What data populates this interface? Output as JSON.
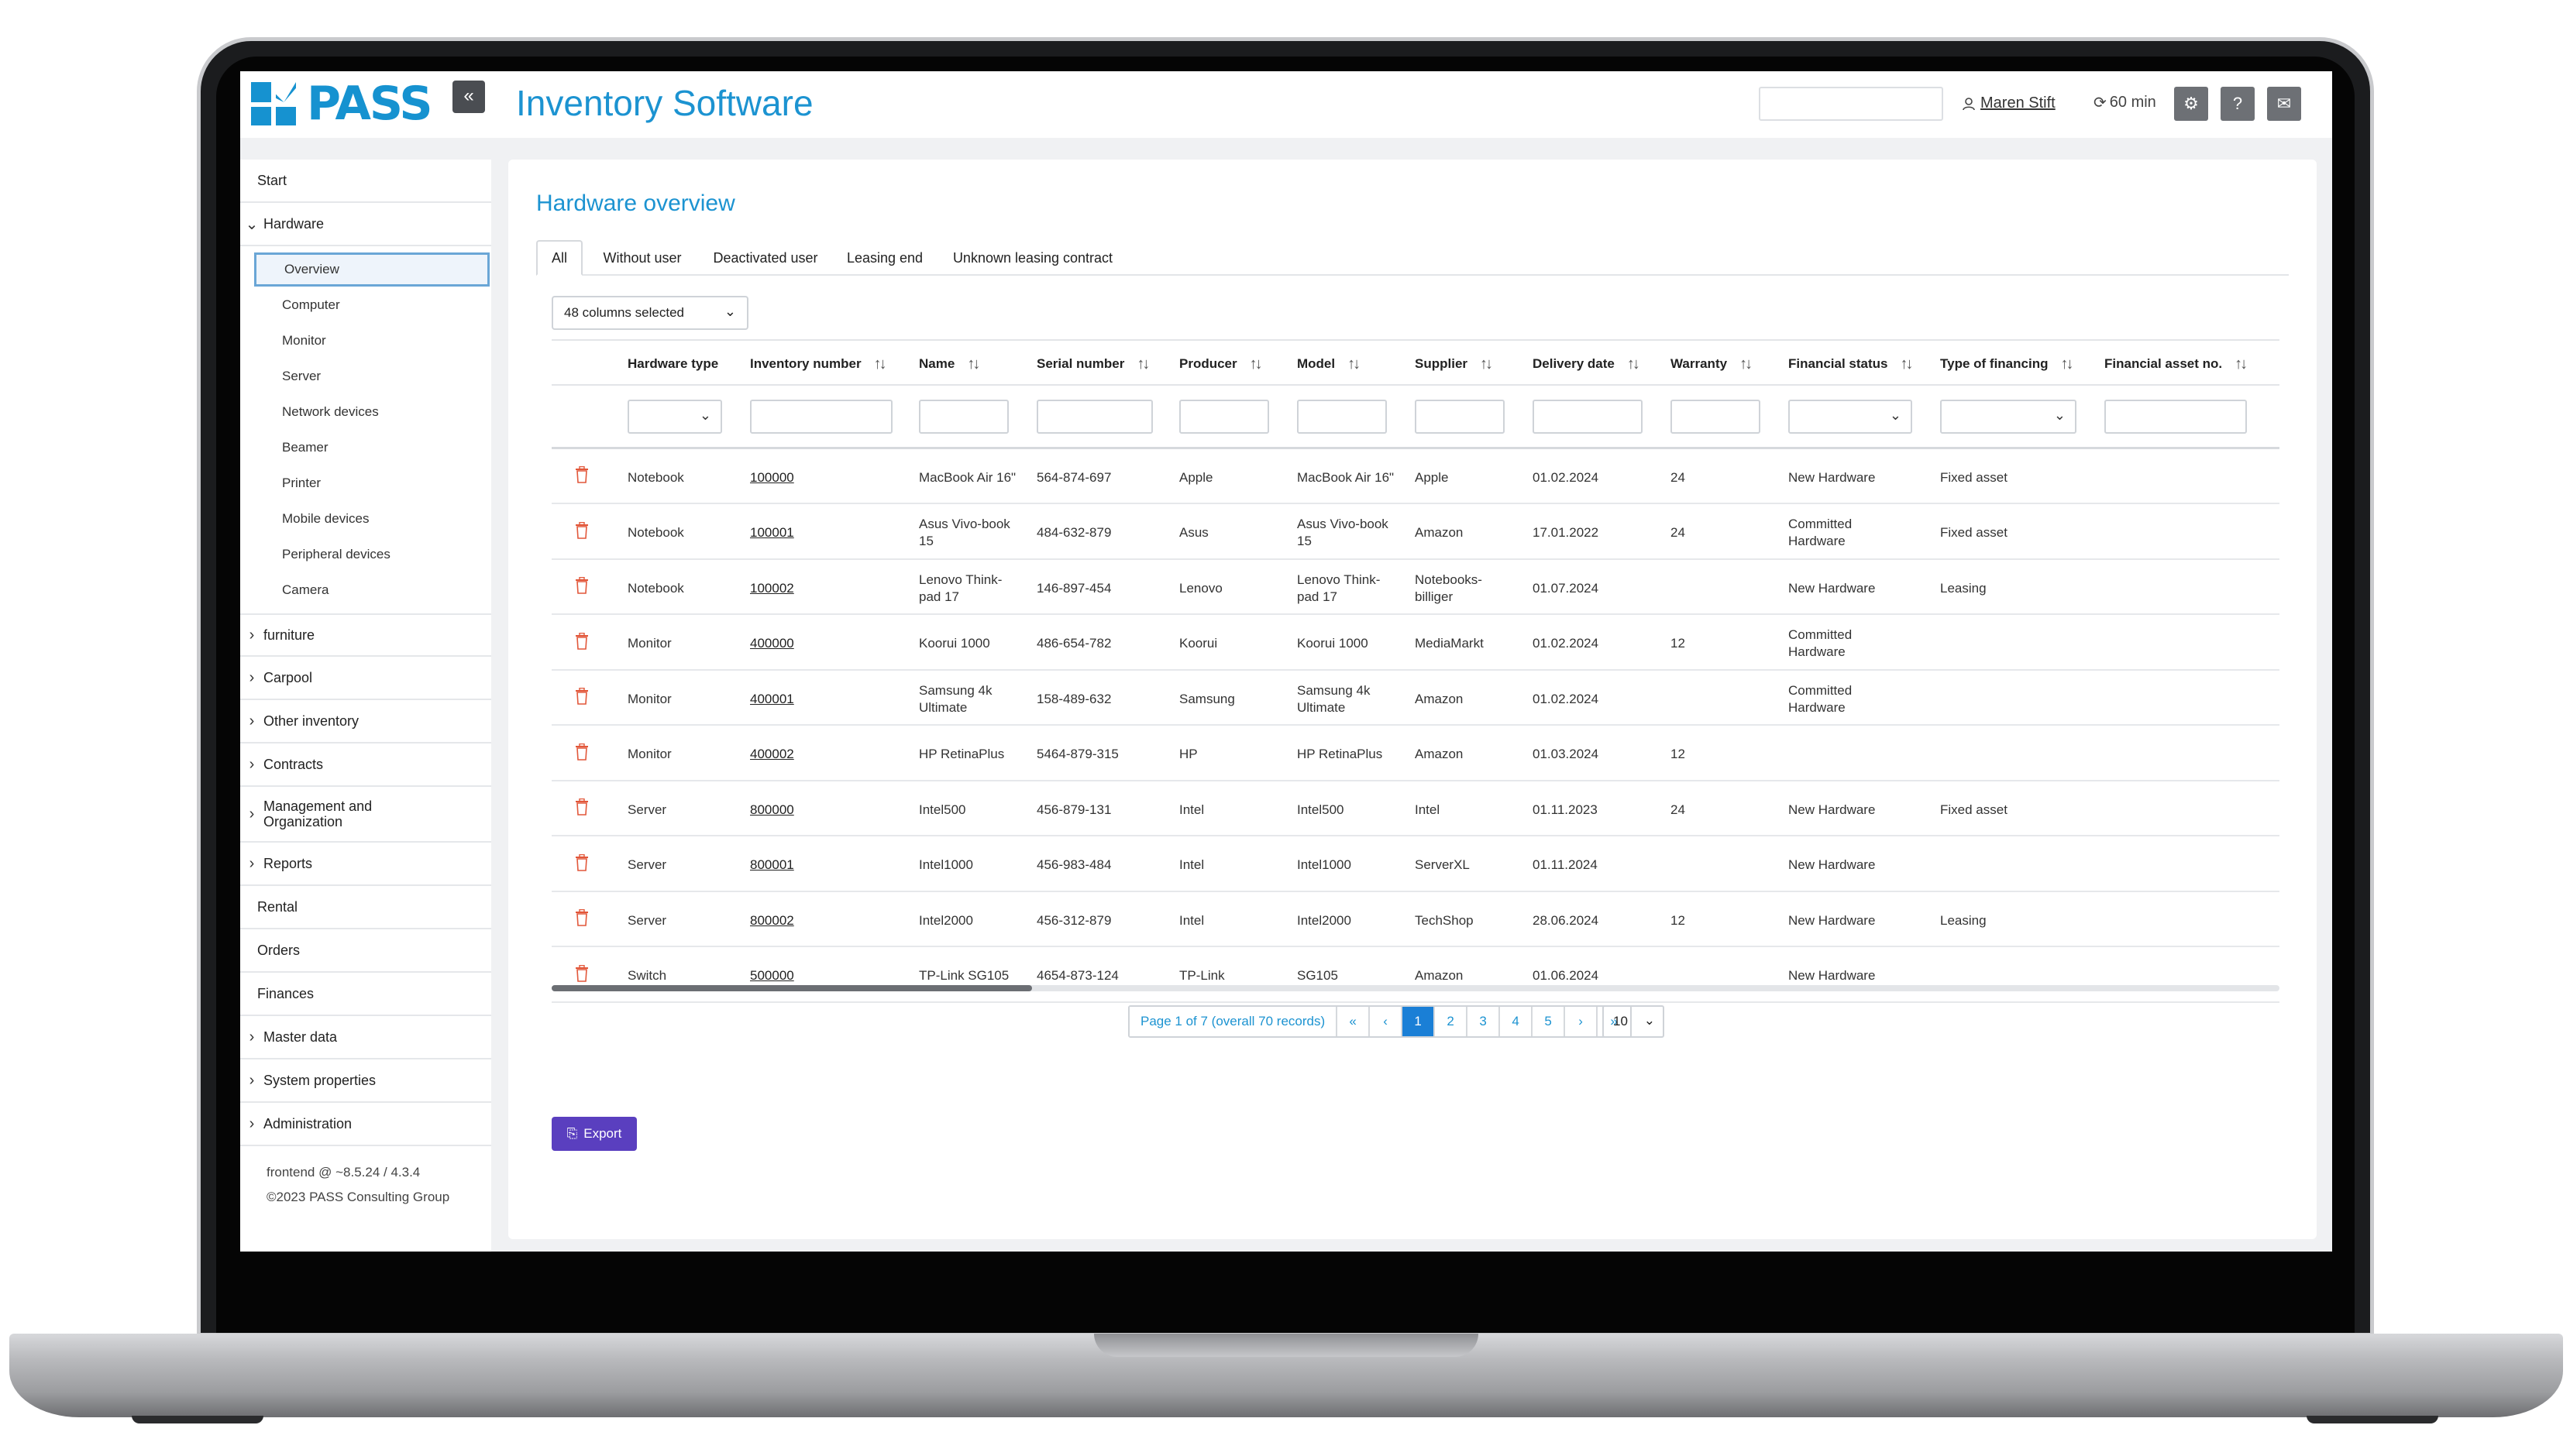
{
  "header": {
    "logo_text": "PASS",
    "collapse_icon": "«",
    "app_title": "Inventory Software",
    "search_value": "",
    "user_name": "Maren Stift",
    "session_timer": "60 min"
  },
  "sidebar": {
    "items": [
      {
        "label": "Start"
      },
      {
        "label": "Hardware",
        "chevron": "expanded"
      },
      {
        "label": "furniture"
      },
      {
        "label": "Carpool"
      },
      {
        "label": "Other inventory"
      },
      {
        "label": "Contracts"
      },
      {
        "label": "Management and Organization"
      },
      {
        "label": "Reports"
      },
      {
        "label": "Rental"
      },
      {
        "label": "Orders"
      },
      {
        "label": "Finances"
      },
      {
        "label": "Master data"
      },
      {
        "label": "System properties"
      },
      {
        "label": "Administration"
      }
    ],
    "hardware_sub": [
      {
        "label": "Overview",
        "active": true
      },
      {
        "label": "Computer"
      },
      {
        "label": "Monitor"
      },
      {
        "label": "Server"
      },
      {
        "label": "Network devices"
      },
      {
        "label": "Beamer"
      },
      {
        "label": "Printer"
      },
      {
        "label": "Mobile devices"
      },
      {
        "label": "Peripheral devices"
      },
      {
        "label": "Camera"
      }
    ],
    "version": "frontend @ ~8.5.24 / 4.3.4",
    "copyright": "©2023 PASS Consulting Group"
  },
  "main": {
    "title": "Hardware overview",
    "tabs": [
      "All",
      "Without user",
      "Deactivated user",
      "Leasing end",
      "Unknown leasing contract"
    ],
    "active_tab": "All",
    "columns_selected": "48 columns selected",
    "columns": [
      "Hardware type",
      "Inventory number",
      "Name",
      "Serial number",
      "Producer",
      "Model",
      "Supplier",
      "Delivery date",
      "Warranty",
      "Financial status",
      "Type of financing",
      "Financial asset no."
    ],
    "rows": [
      {
        "type": "Notebook",
        "inv": "100000",
        "name": "MacBook Air 16\"",
        "serial": "564-874-697",
        "producer": "Apple",
        "model": "MacBook Air 16\"",
        "supplier": "Apple",
        "delivery": "01.02.2024",
        "warranty": "24",
        "fin_status": "New Hardware",
        "financing": "Fixed asset",
        "asset_no": ""
      },
      {
        "type": "Notebook",
        "inv": "100001",
        "name": "Asus Vivo-book 15",
        "serial": "484-632-879",
        "producer": "Asus",
        "model": "Asus Vivo-book 15",
        "supplier": "Amazon",
        "delivery": "17.01.2022",
        "warranty": "24",
        "fin_status": "Committed Hardware",
        "financing": "Fixed asset",
        "asset_no": ""
      },
      {
        "type": "Notebook",
        "inv": "100002",
        "name": "Lenovo Think-pad 17",
        "serial": "146-897-454",
        "producer": "Lenovo",
        "model": "Lenovo Think-pad 17",
        "supplier": "Notebooks-billiger",
        "delivery": "01.07.2024",
        "warranty": "",
        "fin_status": "New Hardware",
        "financing": "Leasing",
        "asset_no": ""
      },
      {
        "type": "Monitor",
        "inv": "400000",
        "name": "Koorui 1000",
        "serial": "486-654-782",
        "producer": "Koorui",
        "model": "Koorui 1000",
        "supplier": "MediaMarkt",
        "delivery": "01.02.2024",
        "warranty": "12",
        "fin_status": "Committed Hardware",
        "financing": "",
        "asset_no": ""
      },
      {
        "type": "Monitor",
        "inv": "400001",
        "name": "Samsung 4k Ultimate",
        "serial": "158-489-632",
        "producer": "Samsung",
        "model": "Samsung 4k Ultimate",
        "supplier": "Amazon",
        "delivery": "01.02.2024",
        "warranty": "",
        "fin_status": "Committed Hardware",
        "financing": "",
        "asset_no": ""
      },
      {
        "type": "Monitor",
        "inv": "400002",
        "name": "HP RetinaPlus",
        "serial": "5464-879-315",
        "producer": "HP",
        "model": "HP RetinaPlus",
        "supplier": "Amazon",
        "delivery": "01.03.2024",
        "warranty": "12",
        "fin_status": "",
        "financing": "",
        "asset_no": ""
      },
      {
        "type": "Server",
        "inv": "800000",
        "name": "Intel500",
        "serial": "456-879-131",
        "producer": "Intel",
        "model": "Intel500",
        "supplier": "Intel",
        "delivery": "01.11.2023",
        "warranty": "24",
        "fin_status": "New Hardware",
        "financing": "Fixed asset",
        "asset_no": ""
      },
      {
        "type": "Server",
        "inv": "800001",
        "name": "Intel1000",
        "serial": "456-983-484",
        "producer": "Intel",
        "model": "Intel1000",
        "supplier": "ServerXL",
        "delivery": "01.11.2024",
        "warranty": "",
        "fin_status": "New Hardware",
        "financing": "",
        "asset_no": ""
      },
      {
        "type": "Server",
        "inv": "800002",
        "name": "Intel2000",
        "serial": "456-312-879",
        "producer": "Intel",
        "model": "Intel2000",
        "supplier": "TechShop",
        "delivery": "28.06.2024",
        "warranty": "12",
        "fin_status": "New Hardware",
        "financing": "Leasing",
        "asset_no": ""
      },
      {
        "type": "Switch",
        "inv": "500000",
        "name": "TP-Link SG105",
        "serial": "4654-873-124",
        "producer": "TP-Link",
        "model": "SG105",
        "supplier": "Amazon",
        "delivery": "01.06.2024",
        "warranty": "",
        "fin_status": "New Hardware",
        "financing": "",
        "asset_no": ""
      }
    ],
    "pagination": {
      "info": "Page 1 of 7 (overall 70 records)",
      "first": "«",
      "prev": "‹",
      "pages": [
        "1",
        "2",
        "3",
        "4",
        "5"
      ],
      "active_page": "1",
      "next": "›",
      "last": "»",
      "page_size": "10"
    },
    "export_label": "Export"
  },
  "colors": {
    "accent": "#1c93d1",
    "export": "#5a3fbf",
    "trash": "#e2573a",
    "active_page": "#1a7fd6"
  }
}
